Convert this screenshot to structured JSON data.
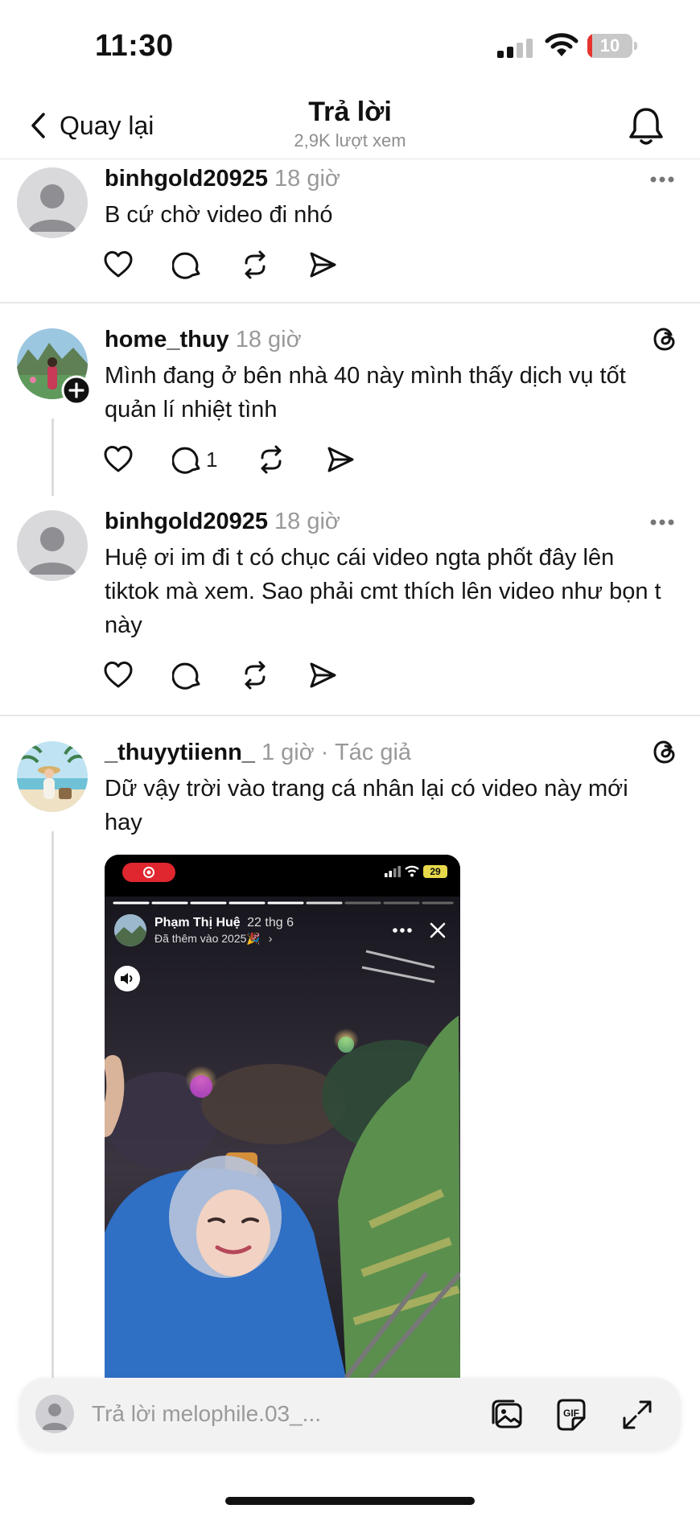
{
  "status_bar": {
    "time": "11:30",
    "battery_percent": "10",
    "battery_level": 0.1,
    "battery_color": "#e5352e"
  },
  "header": {
    "back_label": "Quay lại",
    "title": "Trả lời",
    "subtitle": "2,9K lượt xem"
  },
  "posts": [
    {
      "username": "binhgold20925",
      "time": "18 giờ",
      "text": "B cứ chờ video đi nhó",
      "icons": [
        "heart-icon",
        "comment-icon",
        "repost-icon",
        "share-icon",
        "more-icon"
      ]
    },
    {
      "username": "home_thuy",
      "time": "18 giờ",
      "text": "Mình đang ở bên nhà 40 này mình thấy dịch vụ tốt quản lí nhiệt tình",
      "reply_count": "1",
      "icons": [
        "heart-icon",
        "comment-icon",
        "repost-icon",
        "share-icon",
        "threads-icon",
        "follow-plus-icon"
      ]
    },
    {
      "username": "binhgold20925",
      "time": "18 giờ",
      "text": "Huệ ơi im đi t có chục cái video ngta phốt đây lên tiktok mà xem. Sao phải cmt thích lên video như bọn t này",
      "icons": [
        "heart-icon",
        "comment-icon",
        "repost-icon",
        "share-icon",
        "more-icon"
      ]
    },
    {
      "username": "_thuyytiienn_",
      "time": "1 giờ · Tác giả",
      "text": "Dữ vậy trời vào trang cá nhân lại có video này mới hay",
      "icons": [
        "threads-icon"
      ]
    }
  ],
  "video": {
    "battery": "29",
    "story_user": "Phạm Thị Huệ",
    "story_date": "22 thg 6",
    "story_sub": "Đã thêm vào 2025🎉",
    "chevron": "›"
  },
  "reply_bar": {
    "placeholder": "Trả lời melophile.03_...",
    "icons": [
      "gallery-icon",
      "gif-icon",
      "expand-icon"
    ]
  }
}
